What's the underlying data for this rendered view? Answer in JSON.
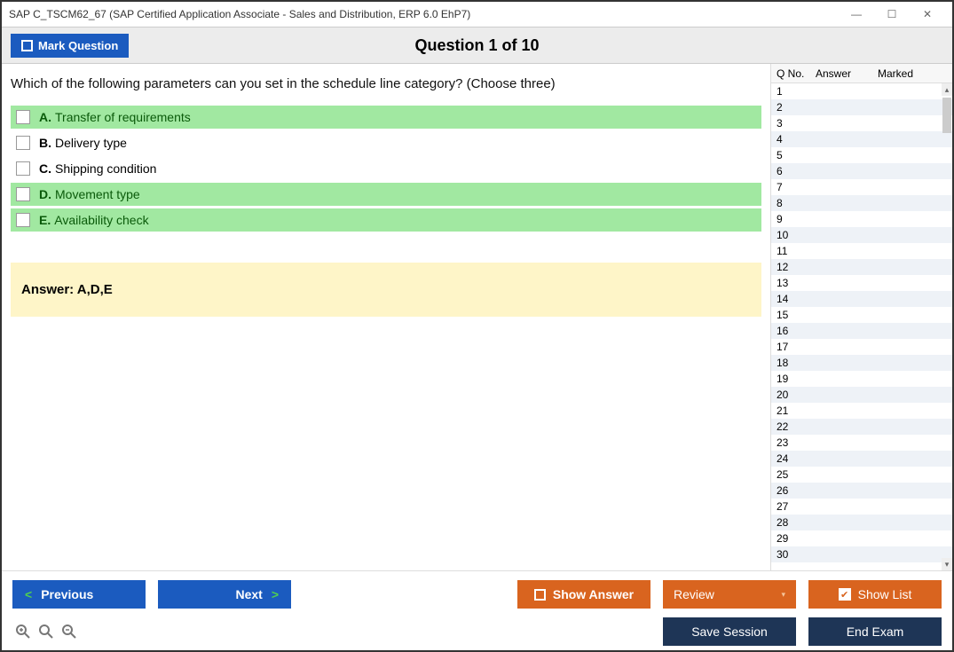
{
  "window": {
    "title": "SAP C_TSCM62_67 (SAP Certified Application Associate - Sales and Distribution, ERP 6.0 EhP7)"
  },
  "topbar": {
    "mark_label": "Mark Question",
    "question_title": "Question 1 of 10"
  },
  "question": {
    "text": "Which of the following parameters can you set in the schedule line category? (Choose three)",
    "options": [
      {
        "letter": "A.",
        "text": "Transfer of requirements",
        "correct": true
      },
      {
        "letter": "B.",
        "text": "Delivery type",
        "correct": false
      },
      {
        "letter": "C.",
        "text": "Shipping condition",
        "correct": false
      },
      {
        "letter": "D.",
        "text": "Movement type",
        "correct": true
      },
      {
        "letter": "E.",
        "text": "Availability check",
        "correct": true
      }
    ],
    "answer_label": "Answer: A,D,E"
  },
  "sidepanel": {
    "headers": {
      "qno": "Q No.",
      "answer": "Answer",
      "marked": "Marked"
    },
    "rows": [
      1,
      2,
      3,
      4,
      5,
      6,
      7,
      8,
      9,
      10,
      11,
      12,
      13,
      14,
      15,
      16,
      17,
      18,
      19,
      20,
      21,
      22,
      23,
      24,
      25,
      26,
      27,
      28,
      29,
      30
    ]
  },
  "footer": {
    "previous": "Previous",
    "next": "Next",
    "show_answer": "Show Answer",
    "review": "Review",
    "show_list": "Show List",
    "save_session": "Save Session",
    "end_exam": "End Exam"
  }
}
